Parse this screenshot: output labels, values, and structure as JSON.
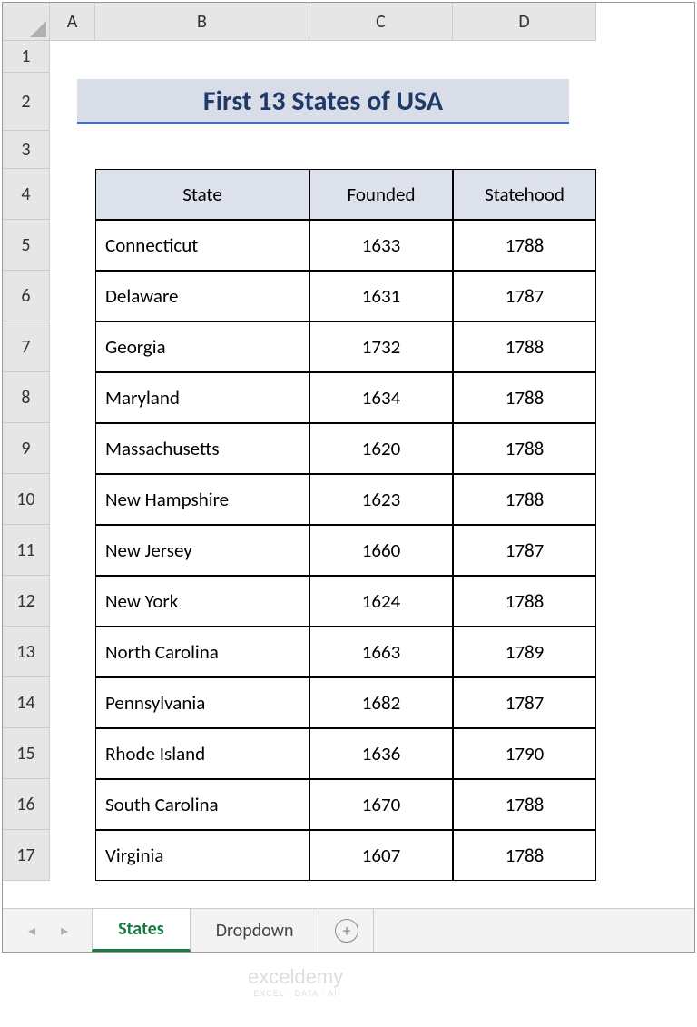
{
  "columns": [
    "A",
    "B",
    "C",
    "D"
  ],
  "row_numbers": [
    1,
    2,
    3,
    4,
    5,
    6,
    7,
    8,
    9,
    10,
    11,
    12,
    13,
    14,
    15,
    16,
    17
  ],
  "title": "First 13 States of USA",
  "table": {
    "headers": [
      "State",
      "Founded",
      "Statehood"
    ],
    "rows": [
      {
        "state": "Connecticut",
        "founded": "1633",
        "statehood": "1788"
      },
      {
        "state": "Delaware",
        "founded": "1631",
        "statehood": "1787"
      },
      {
        "state": "Georgia",
        "founded": "1732",
        "statehood": "1788"
      },
      {
        "state": "Maryland",
        "founded": "1634",
        "statehood": "1788"
      },
      {
        "state": "Massachusetts",
        "founded": "1620",
        "statehood": "1788"
      },
      {
        "state": "New Hampshire",
        "founded": "1623",
        "statehood": "1788"
      },
      {
        "state": "New Jersey",
        "founded": "1660",
        "statehood": "1787"
      },
      {
        "state": "New York",
        "founded": "1624",
        "statehood": "1788"
      },
      {
        "state": "North Carolina",
        "founded": "1663",
        "statehood": "1789"
      },
      {
        "state": "Pennsylvania",
        "founded": "1682",
        "statehood": "1787"
      },
      {
        "state": "Rhode Island",
        "founded": "1636",
        "statehood": "1790"
      },
      {
        "state": "South Carolina",
        "founded": "1670",
        "statehood": "1788"
      },
      {
        "state": "Virginia",
        "founded": "1607",
        "statehood": "1788"
      }
    ]
  },
  "tabs": {
    "active": "States",
    "inactive": "Dropdown"
  },
  "nav": {
    "left": "◂",
    "right": "▸",
    "plus": "+"
  },
  "watermark": {
    "main": "exceldemy",
    "sub": "EXCEL · DATA · AI"
  }
}
